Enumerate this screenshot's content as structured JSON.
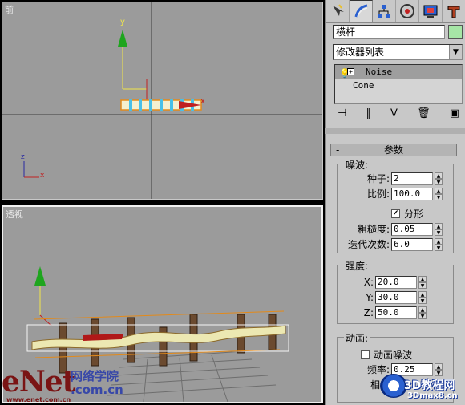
{
  "viewports": {
    "front": {
      "label": "前"
    },
    "perspective": {
      "label": "透视"
    }
  },
  "axes": {
    "x": "x",
    "y": "y",
    "z": "z"
  },
  "panel": {
    "tabs": [
      "create-icon",
      "modify-icon",
      "hierarchy-icon",
      "motion-icon",
      "display-icon",
      "utilities-icon"
    ],
    "object_name": "横杆",
    "modifier_list": "修改器列表",
    "stack": [
      {
        "label": "Noise",
        "selected": true
      },
      {
        "label": "Cone",
        "selected": false
      }
    ],
    "params": {
      "title": "参数",
      "noise_group": "噪波:",
      "seed_label": "种子:",
      "seed_value": "2",
      "scale_label": "比例:",
      "scale_value": "100.0",
      "fractal_label": "分形",
      "fractal_checked": true,
      "roughness_label": "粗糙度:",
      "roughness_value": "0.05",
      "iterations_label": "迭代次数:",
      "iterations_value": "6.0",
      "strength_group": "强度:",
      "x_label": "X:",
      "x_value": "20.0",
      "y_label": "Y:",
      "y_value": "30.0",
      "z_label": "Z:",
      "z_value": "50.0",
      "animation_group": "动画:",
      "animate_noise_label": "动画噪波",
      "frequency_label": "频率:",
      "frequency_value": "0.25",
      "phase_label": "相位"
    }
  },
  "watermarks": {
    "enet": "eNet",
    "enet_sub": "网络学院",
    "enet_url": ".com.cn",
    "enet_domain": "www.enet.com.cn",
    "site": "3D教程网",
    "site_url": "3Dmax8.cn"
  }
}
